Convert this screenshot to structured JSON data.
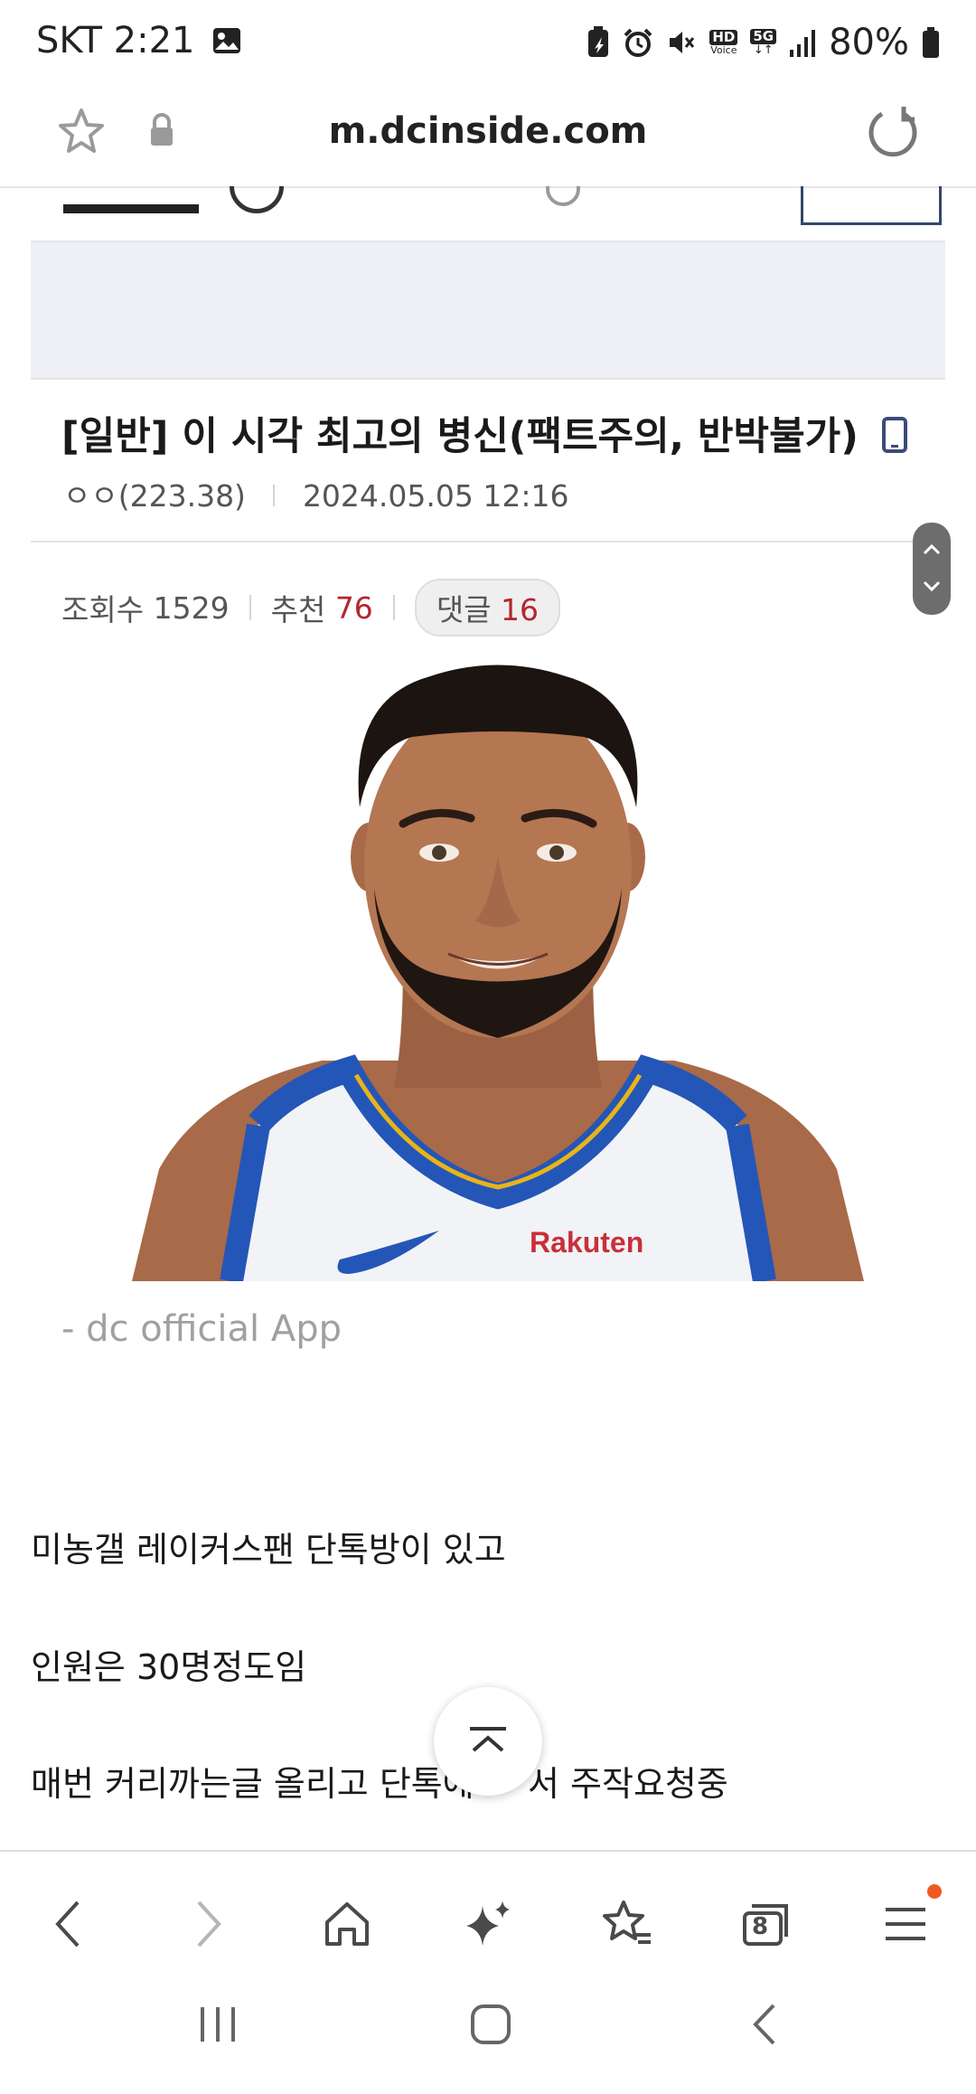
{
  "status_bar": {
    "carrier_time": "SKT 2:21",
    "net_type": "5G",
    "hd_label": "HD",
    "hd_sub": "Voice",
    "battery": "80%"
  },
  "address_bar": {
    "url": "m.dcinside.com"
  },
  "post": {
    "title": "[일반] 이 시각 최고의 병신(팩트주의, 반박불가)",
    "author": "ㅇㅇ(223.38)",
    "date": "2024.05.05 12:16",
    "views_label": "조회수",
    "views": "1529",
    "recommend_label": "추천",
    "recommend": "76",
    "comments_label": "댓글",
    "comments": "16",
    "jersey_text": "Rakuten",
    "caption": "- dc official App",
    "body_lines": [
      "미농갤 레이커스팬 단톡방이 있고",
      "인원은 30명정도임",
      "매번 커리까는글 올리고 단톡에",
      "서 주작요청중"
    ]
  },
  "bottom_nav": {
    "tab_count": "8"
  },
  "colors": {
    "accent_red": "#b3262d",
    "notification_dot": "#f05a22",
    "nav_icon": "#4a4a4a"
  }
}
